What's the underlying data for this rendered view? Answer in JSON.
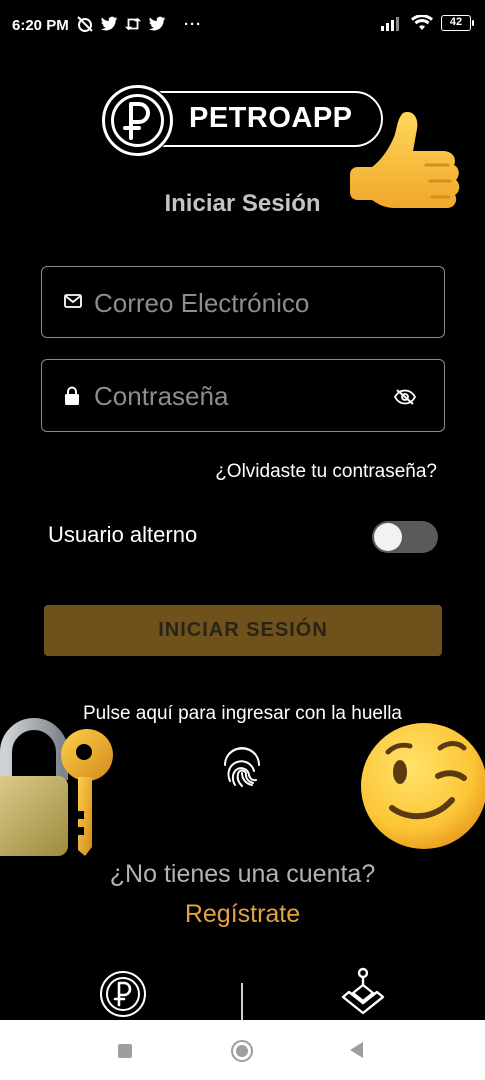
{
  "status_bar": {
    "time": "6:20 PM",
    "more": "···",
    "battery": "42",
    "icons": [
      "muted-alarm-icon",
      "twitter-icon",
      "retweet-icon",
      "twitter-icon",
      "signal-icon",
      "wifi-icon",
      "battery-icon"
    ]
  },
  "logo": {
    "text": "PETROAPP",
    "icon": "petro-coin-icon"
  },
  "login": {
    "title": "Iniciar Sesión",
    "email_placeholder": "Correo Electrónico",
    "password_placeholder": "Contraseña",
    "forgot_password": "¿Olvidaste tu contraseña?",
    "alternate_user_label": "Usuario alterno",
    "alternate_user_enabled": false,
    "submit_label": "INICIAR SESIÓN",
    "fingerprint_prompt": "Pulse aquí para ingresar con la huella"
  },
  "register": {
    "question": "¿No tienes una cuenta?",
    "link": "Regístrate"
  },
  "colors": {
    "background": "#000000",
    "accent": "#e1a246",
    "button": "#6e511b"
  },
  "nav_bar": {
    "icons": [
      "recents-icon",
      "home-icon",
      "back-icon"
    ]
  }
}
